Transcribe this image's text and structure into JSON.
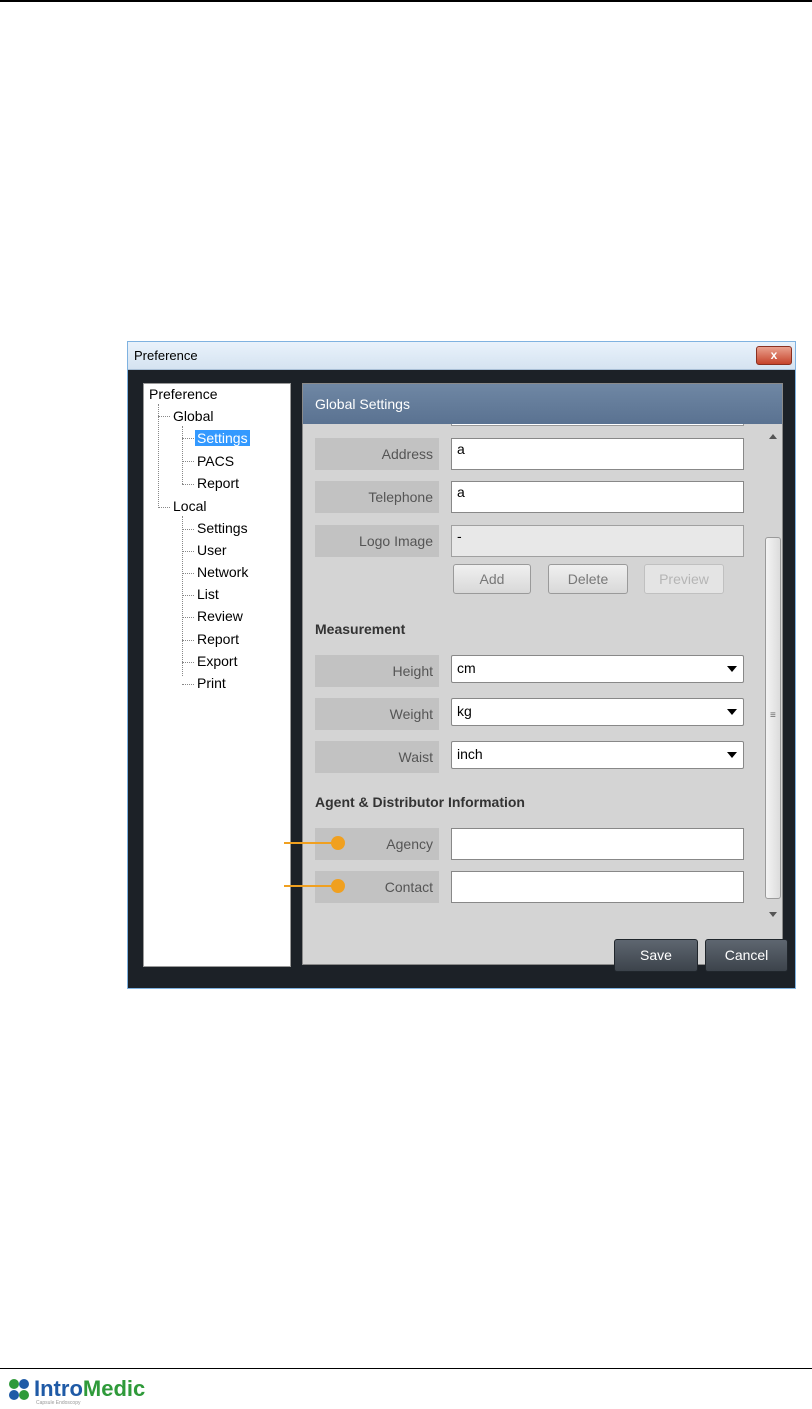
{
  "dialog": {
    "title": "Preference",
    "close_label": "x",
    "save_label": "Save",
    "cancel_label": "Cancel"
  },
  "tree": {
    "root": "Preference",
    "global": "Global",
    "global_children": [
      "Settings",
      "PACS",
      "Report"
    ],
    "local": "Local",
    "local_children": [
      "Settings",
      "User",
      "Network",
      "List",
      "Review",
      "Report",
      "Export",
      "Print"
    ],
    "selected": "Global > Settings"
  },
  "panel": {
    "header": "Global Settings",
    "address_label": "Address",
    "address_value": "a",
    "telephone_label": "Telephone",
    "telephone_value": "a",
    "logo_label": "Logo Image",
    "logo_value": "-",
    "add_label": "Add",
    "delete_label": "Delete",
    "preview_label": "Preview",
    "measurement_heading": "Measurement",
    "height_label": "Height",
    "height_value": "cm",
    "weight_label": "Weight",
    "weight_value": "kg",
    "waist_label": "Waist",
    "waist_value": "inch",
    "agent_heading": "Agent & Distributor Information",
    "agency_label": "Agency",
    "agency_value": "",
    "contact_label": "Contact",
    "contact_value": ""
  },
  "footer": {
    "logo_intro": "Intro",
    "logo_medic": "Medic",
    "logo_tagline": "Capsule Endoscopy"
  },
  "colors": {
    "callout": "#f0a020",
    "selection": "#3399ff",
    "header_bar": "#6f87a4",
    "logo_blue": "#1f5aa6",
    "logo_green": "#2f9a3a"
  }
}
